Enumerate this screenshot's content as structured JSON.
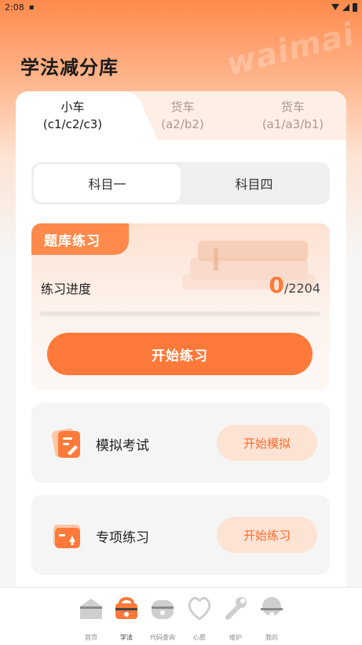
{
  "status_bar": {
    "time": "2:08"
  },
  "watermark": "waimai",
  "page_title": "学法减分库",
  "vehicle_tabs": [
    {
      "line1": "小车",
      "line2": "(c1/c2/c3)"
    },
    {
      "line1": "货车",
      "line2": "(a2/b2)"
    },
    {
      "line1": "货车",
      "line2": "(a1/a3/b1)"
    }
  ],
  "subjects": [
    "科目一",
    "科目四"
  ],
  "practice": {
    "badge": "题库练习",
    "progress_label": "练习进度",
    "done": "0",
    "total": "/2204",
    "progress_fraction": 0,
    "start_label": "开始练习"
  },
  "features": [
    {
      "label": "模拟考试",
      "button": "开始模拟",
      "icon": "exam-doc-icon"
    },
    {
      "label": "专项练习",
      "button": "开始练习",
      "icon": "open-book-icon"
    }
  ],
  "bottom_nav": [
    {
      "label": "首页",
      "icon": "home-icon",
      "active": false
    },
    {
      "label": "学法",
      "icon": "study-icon",
      "active": true
    },
    {
      "label": "代码查询",
      "icon": "code-query-icon",
      "active": false
    },
    {
      "label": "心愿",
      "icon": "heart-icon",
      "active": false
    },
    {
      "label": "维护",
      "icon": "wrench-icon",
      "active": false
    },
    {
      "label": "我的",
      "icon": "profile-icon",
      "active": false
    }
  ],
  "colors": {
    "accent": "#ff7a3a",
    "accent_light": "#fde3d4",
    "hero_top": "#ff8a4c"
  }
}
